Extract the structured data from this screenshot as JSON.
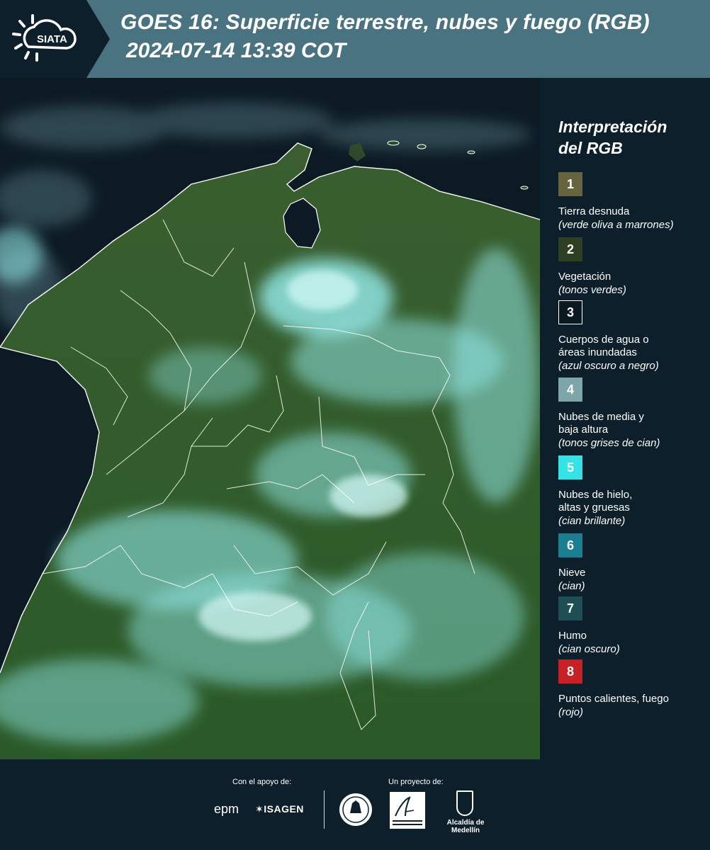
{
  "header": {
    "logo_text": "SIATA",
    "title": "GOES 16: Superficie terrestre, nubes y fuego (RGB)",
    "subtitle": "2024-07-14 13:39 COT",
    "background": "#4a7382"
  },
  "map": {
    "land_color": "#2e5a2a",
    "ocean_color": "#0b1a22",
    "cloud_color": "#7fe6e6",
    "border_color": "#ffffff"
  },
  "legend": {
    "title_line1": "Interpretación",
    "title_line2": "del RGB",
    "items": [
      {
        "number": "1",
        "label": "Tierra desnuda",
        "desc": "(verde oliva a marrones)",
        "color": "#67653f"
      },
      {
        "number": "2",
        "label": "Vegetación",
        "desc": "(tonos verdes)",
        "color": "#2d4023"
      },
      {
        "number": "3",
        "label": "Cuerpos de agua o",
        "label2": "áreas inundadas",
        "desc": "(azul oscuro a negro)",
        "color": "#0b1a22"
      },
      {
        "number": "4",
        "label": "Nubes de media y",
        "label2": "baja altura",
        "desc": "(tonos grises de cian)",
        "color": "#7ea5a8"
      },
      {
        "number": "5",
        "label": "Nubes de hielo,",
        "label2": "altas y gruesas",
        "desc": "(cian brillante)",
        "color": "#35e3e6"
      },
      {
        "number": "6",
        "label": "Nieve",
        "desc": "(cian)",
        "color": "#1c7e91"
      },
      {
        "number": "7",
        "label": "Humo",
        "desc": "(cian oscuro)",
        "color": "#1d4f54"
      },
      {
        "number": "8",
        "label": "Puntos calientes, fuego",
        "desc": "(rojo)",
        "color": "#c52126"
      }
    ]
  },
  "footer": {
    "support_label": "Con el apoyo de:",
    "project_label": "Un proyecto de:",
    "sponsors": [
      "epm",
      "ISAGEN"
    ],
    "partners": [
      "Área Metropolitana Valle de Aburrá",
      "Alcaldía de Medellín"
    ]
  }
}
